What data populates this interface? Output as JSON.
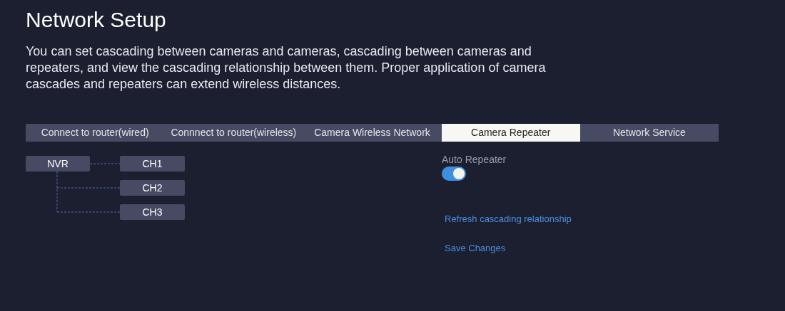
{
  "title": "Network Setup",
  "description": "You can set cascading between cameras and cameras, cascading between cameras and repeaters, and view the cascading relationship between them. Proper application of camera cascades and repeaters can extend wireless distances.",
  "tabs": [
    {
      "label": "Connect to router(wired)",
      "selected": false
    },
    {
      "label": "Connnect to router(wireless)",
      "selected": false
    },
    {
      "label": "Camera Wireless Network",
      "selected": false
    },
    {
      "label": "Camera Repeater",
      "selected": true
    },
    {
      "label": "Network Service",
      "selected": false
    }
  ],
  "tree": {
    "label": "NVR",
    "children": [
      {
        "label": "CH1"
      },
      {
        "label": "CH2"
      },
      {
        "label": "CH3"
      }
    ]
  },
  "auto_repeater": {
    "label": "Auto Repeater",
    "on": true
  },
  "links": [
    "Refresh cascading relationship",
    "Save Changes"
  ]
}
